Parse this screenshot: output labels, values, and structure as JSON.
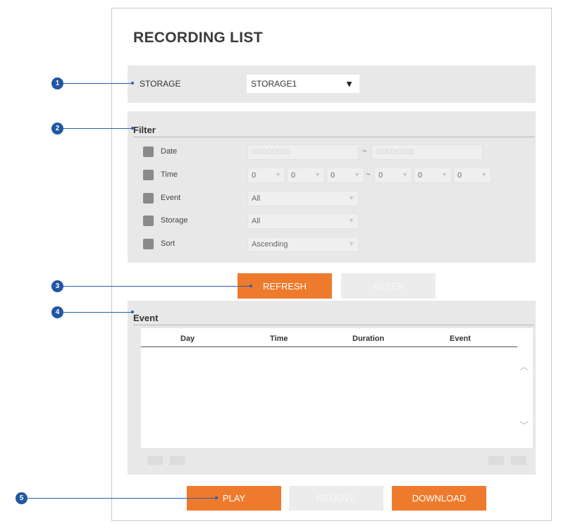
{
  "title": "RECORDING LIST",
  "storage": {
    "label": "STORAGE",
    "selected": "STORAGE1",
    "arrow": "▼"
  },
  "filter": {
    "heading": "Filter",
    "date": {
      "label": "Date",
      "from": "00/00/0000",
      "sep": "~",
      "to": "00/00/0000"
    },
    "time": {
      "label": "Time",
      "from": [
        "0",
        "0",
        "0"
      ],
      "sep": "~",
      "to": [
        "0",
        "0",
        "0"
      ]
    },
    "event": {
      "label": "Event",
      "value": "All"
    },
    "storage": {
      "label": "Storage",
      "value": "All"
    },
    "sort": {
      "label": "Sort",
      "value": "Ascending"
    },
    "dropdown_glyph": "▼"
  },
  "buttons": {
    "refresh": "REFRESH",
    "filter": "FILTER",
    "play": "PLAY",
    "remove": "REMOVE",
    "download": "DOWNLOAD"
  },
  "event_table": {
    "heading": "Event",
    "columns": [
      "Day",
      "Time",
      "Duration",
      "Event"
    ],
    "rows": [],
    "scroll_up": "︿",
    "scroll_down": "﹀"
  },
  "markers": [
    "1",
    "2",
    "3",
    "4",
    "5"
  ],
  "colors": {
    "accent": "#ee7b2d",
    "marker": "#1f57a3",
    "panel": "#e8e8e8"
  }
}
